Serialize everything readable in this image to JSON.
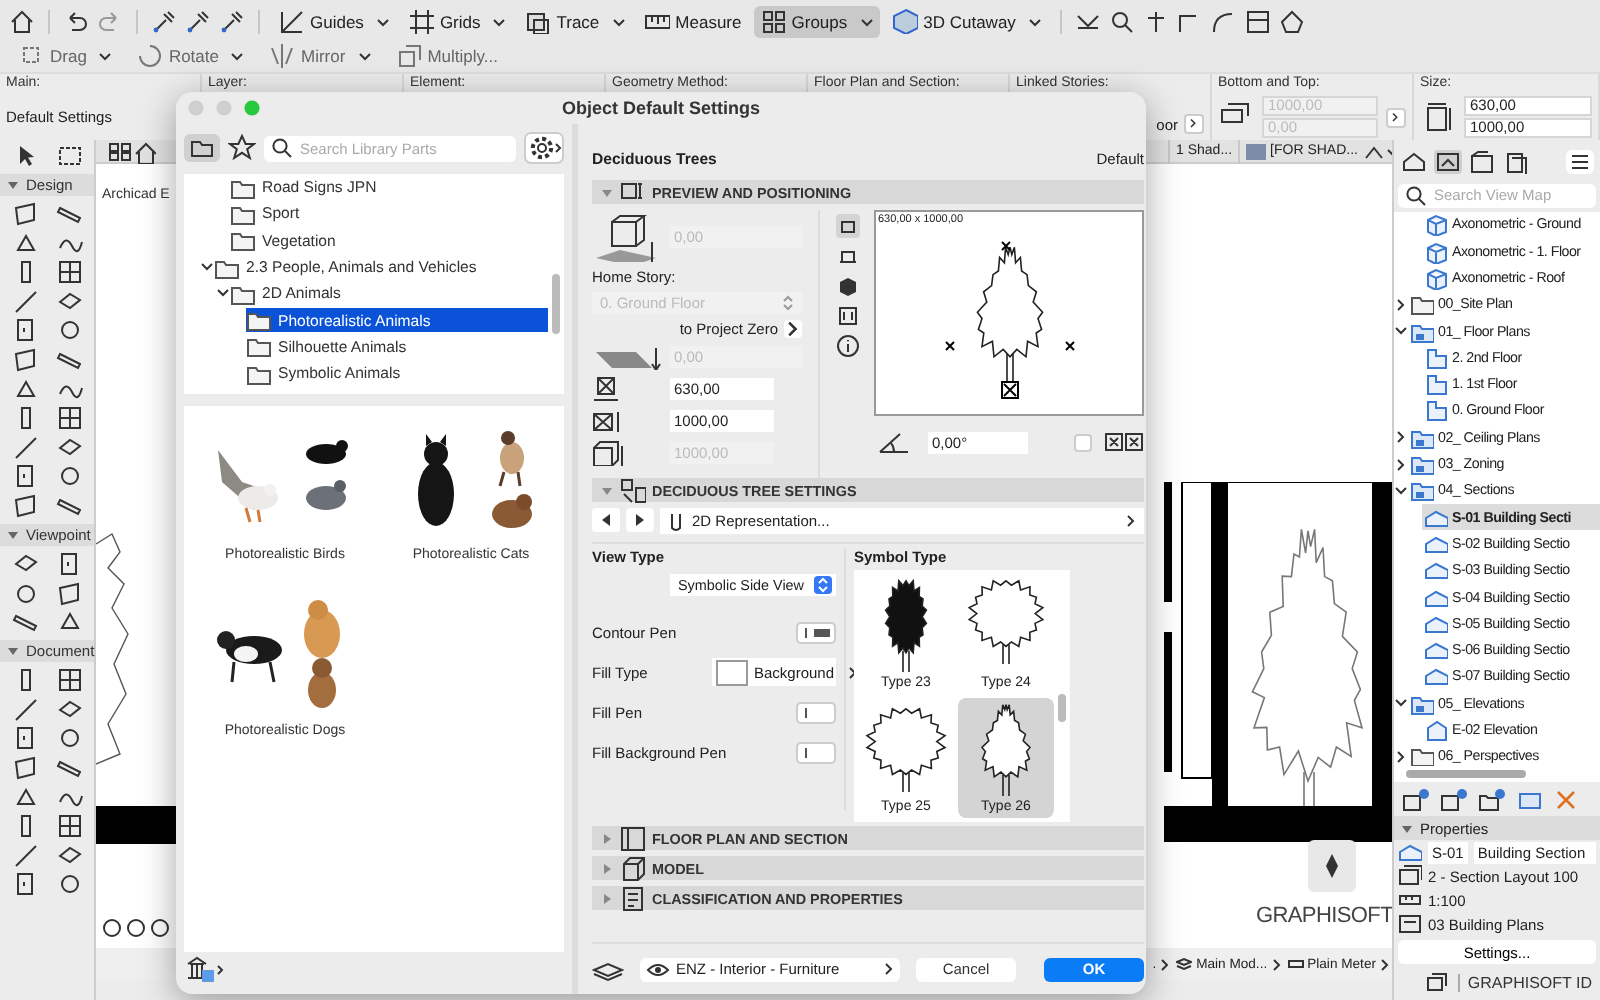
{
  "toolbar": {
    "tools": [
      {
        "label": "Guides",
        "on": false,
        "menu": true
      },
      {
        "label": "Grids",
        "on": false,
        "menu": true
      },
      {
        "label": "Trace",
        "on": false,
        "menu": true
      },
      {
        "label": "Measure",
        "on": false,
        "menu": false
      },
      {
        "label": "Groups",
        "on": true,
        "menu": true
      },
      {
        "label": "3D Cutaway",
        "on": false,
        "menu": true
      }
    ],
    "edit_tools": [
      {
        "label": "Drag",
        "menu": true
      },
      {
        "label": "Rotate",
        "menu": true
      },
      {
        "label": "Mirror",
        "menu": true
      },
      {
        "label": "Multiply...",
        "menu": false
      }
    ]
  },
  "info_box": {
    "headings": [
      "Main:",
      "Layer:",
      "Element:",
      "Geometry Method:",
      "Floor Plan and Section:",
      "Linked Stories:",
      "Bottom and Top:",
      "Size:"
    ],
    "main_value": "Default Settings",
    "linked_value": "oor",
    "bottom_top": [
      {
        "value": "1000,00",
        "disabled": true
      },
      {
        "value": "0,00",
        "disabled": true
      }
    ],
    "size": [
      {
        "value": "630,00",
        "disabled": false
      },
      {
        "value": "1000,00",
        "disabled": false
      }
    ]
  },
  "view_tabs": [
    {
      "label": "1 Shad..."
    },
    {
      "label": "[FOR SHAD..."
    }
  ],
  "toolbox": {
    "sections": [
      {
        "label": "Design",
        "expanded": true
      },
      {
        "label": "Viewpoint",
        "expanded": true
      },
      {
        "label": "Document",
        "expanded": true
      }
    ]
  },
  "canvas": {
    "label": "Archicad E",
    "logo": "GRAPHISOFT"
  },
  "status_bar": [
    {
      "label": "."
    },
    {
      "label": "Main Mod..."
    },
    {
      "label": "Plain Meter"
    }
  ],
  "navigator": {
    "search_placeholder": "Search View Map",
    "tree": [
      {
        "children": [
          {
            "label": "Axonometric - Ground",
            "kind": "axo",
            "selected": false
          },
          {
            "label": "Axonometric - 1. Floor",
            "kind": "axo",
            "selected": false
          },
          {
            "label": "Axonometric - Roof",
            "kind": "axo",
            "selected": false
          }
        ]
      },
      {
        "label": "00_Site Plan",
        "kind": "folder",
        "selected": false,
        "expanded": false
      },
      {
        "label": "01_ Floor Plans",
        "kind": "set",
        "selected": false,
        "expanded": true,
        "children": [
          {
            "label": "2. 2nd Floor",
            "kind": "plan",
            "selected": false
          },
          {
            "label": "1. 1st Floor",
            "kind": "plan",
            "selected": false
          },
          {
            "label": "0. Ground Floor",
            "kind": "plan",
            "selected": false
          }
        ]
      },
      {
        "label": "02_ Ceiling Plans",
        "kind": "set",
        "selected": false,
        "expanded": false
      },
      {
        "label": "03_ Zoning",
        "kind": "set",
        "selected": false,
        "expanded": false
      },
      {
        "label": "04_ Sections",
        "kind": "set",
        "selected": false,
        "expanded": true,
        "children": [
          {
            "label": "S-01 Building Secti",
            "kind": "section",
            "selected": true
          },
          {
            "label": "S-02 Building Sectio",
            "kind": "section",
            "selected": false
          },
          {
            "label": "S-03 Building Sectio",
            "kind": "section",
            "selected": false
          },
          {
            "label": "S-04 Building Sectio",
            "kind": "section",
            "selected": false
          },
          {
            "label": "S-05 Building Sectio",
            "kind": "section",
            "selected": false
          },
          {
            "label": "S-06 Building Sectio",
            "kind": "section",
            "selected": false
          },
          {
            "label": "S-07 Building Sectio",
            "kind": "section",
            "selected": false
          }
        ]
      },
      {
        "label": "05_ Elevations",
        "kind": "set",
        "selected": false,
        "expanded": true,
        "children": [
          {
            "label": "E-02 Elevation",
            "kind": "elevation",
            "selected": false
          }
        ]
      },
      {
        "label": "06_ Perspectives",
        "kind": "folder",
        "selected": false,
        "expanded": false
      }
    ]
  },
  "properties": {
    "title": "Properties",
    "expanded": true,
    "id": "S-01",
    "name": "Building Section",
    "layout": "2 - Section Layout 100",
    "scale": "1:100",
    "set": "03 Building Plans",
    "button": "Settings..."
  },
  "account": {
    "label": "GRAPHISOFT ID"
  },
  "dialog": {
    "title": "Object Default Settings",
    "library": {
      "search_placeholder": "Search Library Parts",
      "tree": [
        {
          "children": [
            {
              "children": [
                {
                  "label": "Road Signs JPN",
                  "selected": false
                },
                {
                  "label": "Sport",
                  "selected": false
                },
                {
                  "label": "Vegetation",
                  "selected": false
                }
              ]
            },
            {
              "label": "2.3 People, Animals and Vehicles",
              "selected": false,
              "expanded": true,
              "children": [
                {
                  "label": "2D Animals",
                  "selected": false,
                  "expanded": true,
                  "children": [
                    {
                      "label": "Photorealistic Animals",
                      "selected": true
                    },
                    {
                      "label": "Silhouette Animals",
                      "selected": false
                    },
                    {
                      "label": "Symbolic Animals",
                      "selected": false
                    }
                  ]
                }
              ]
            }
          ]
        }
      ],
      "items": [
        {
          "label": "Photorealistic Birds",
          "kind": "birds"
        },
        {
          "label": "Photorealistic Cats",
          "kind": "cats"
        },
        {
          "label": "Photorealistic Dogs",
          "kind": "dogs"
        }
      ]
    },
    "part_name": "Deciduous Trees",
    "part_state": "Default",
    "sections": [
      {
        "title": "PREVIEW AND POSITIONING",
        "kind": "preview",
        "expanded": true
      },
      {
        "title": "DECIDUOUS TREE SETTINGS",
        "kind": "settings",
        "expanded": true
      },
      {
        "title": "FLOOR PLAN AND SECTION",
        "kind": "plan",
        "expanded": false
      },
      {
        "title": "MODEL",
        "kind": "model",
        "expanded": false
      },
      {
        "title": "CLASSIFICATION AND PROPERTIES",
        "kind": "classification",
        "expanded": false
      }
    ],
    "preview": {
      "elevation": {
        "value": "0,00",
        "disabled": true
      },
      "home_story_label": "Home Story:",
      "home_story": {
        "value": "0. Ground Floor",
        "disabled": true
      },
      "reference": "to Project Zero",
      "fields": [
        {
          "kind": "offset",
          "value": "0,00",
          "disabled": true
        },
        {
          "kind": "width",
          "value": "630,00",
          "disabled": false
        },
        {
          "kind": "height",
          "value": "1000,00",
          "disabled": false
        },
        {
          "kind": "total",
          "value": "1000,00",
          "disabled": true
        }
      ],
      "size_label": "630,00 x 1000,00",
      "angle": "0,00°",
      "mirrored": false
    },
    "settings": {
      "page": "2D Representation...",
      "view_type_label": "View Type",
      "view_type": "Symbolic Side View",
      "rows": [
        {
          "label": "Contour Pen",
          "kind": "pen",
          "filled": true
        },
        {
          "label": "Fill Type",
          "kind": "fill",
          "value": "Background"
        },
        {
          "label": "Fill Pen",
          "kind": "pen",
          "filled": false
        },
        {
          "label": "Fill Background Pen",
          "kind": "pen",
          "filled": false
        }
      ],
      "symbol_label": "Symbol Type",
      "symbols": [
        {
          "label": "Type 23",
          "kind": "solid",
          "selected": false
        },
        {
          "label": "Type 24",
          "kind": "round",
          "selected": false
        },
        {
          "label": "Type 25",
          "kind": "spread",
          "selected": false
        },
        {
          "label": "Type 26",
          "kind": "cone",
          "selected": true
        }
      ]
    },
    "layer": "ENZ - Interior - Furniture",
    "buttons": [
      {
        "label": "Cancel",
        "kind": "secondary"
      },
      {
        "label": "OK",
        "kind": "primary"
      }
    ]
  }
}
